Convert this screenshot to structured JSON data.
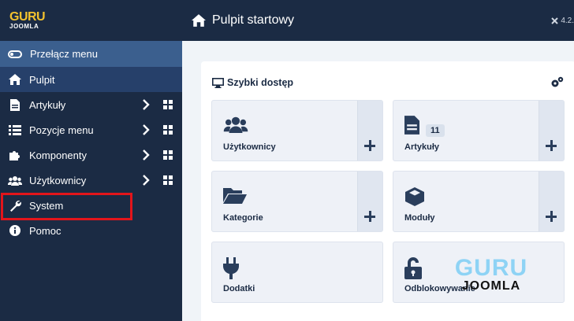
{
  "brand": {
    "logo_line1": "GURU",
    "logo_line2": "JOOMLA"
  },
  "header": {
    "title": "Pulpit startowy",
    "version": "4.2."
  },
  "sidebar": {
    "toggle_label": "Przełącz menu",
    "items": [
      {
        "label": "Pulpit",
        "icon": "home-icon",
        "active": true
      },
      {
        "label": "Artykuły",
        "icon": "file-icon"
      },
      {
        "label": "Pozycje menu",
        "icon": "list-icon"
      },
      {
        "label": "Komponenty",
        "icon": "puzzle-icon"
      },
      {
        "label": "Użytkownicy",
        "icon": "users-icon"
      },
      {
        "label": "System",
        "icon": "wrench-icon",
        "highlighted": true
      },
      {
        "label": "Pomoc",
        "icon": "info-icon"
      }
    ]
  },
  "quick_access": {
    "title": "Szybki dostęp",
    "tiles": [
      {
        "label": "Użytkownicy",
        "icon": "users-icon",
        "has_add": true
      },
      {
        "label": "Artykuły",
        "icon": "file-icon",
        "badge": "11",
        "has_add": true
      },
      {
        "label": "Kategorie",
        "icon": "folder-icon",
        "has_add": true
      },
      {
        "label": "Moduły",
        "icon": "cube-icon",
        "has_add": true
      },
      {
        "label": "Dodatki",
        "icon": "plug-icon"
      },
      {
        "label": "Odblokowywanie",
        "icon": "unlock-icon"
      }
    ]
  },
  "watermark": {
    "line1": "GURU",
    "line2": "JOOMLA"
  },
  "colors": {
    "sidebar_bg": "#1b2b44",
    "toggle_bg": "#3b5f8e",
    "highlight": "#e3151b",
    "accent_logo": "#f2c12e",
    "watermark_blue": "#8ed3f5"
  }
}
